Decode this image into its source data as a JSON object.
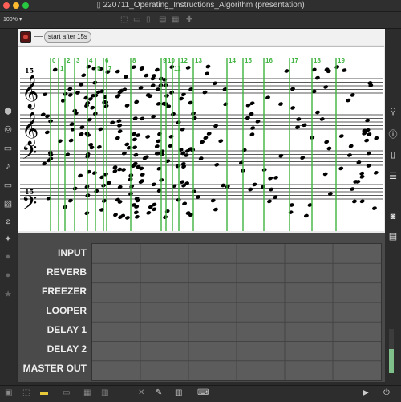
{
  "window": {
    "title": "220711_Operating_Instructions_Algorithm (presentation)"
  },
  "toolbar": {
    "zoom": "100%",
    "zoom_caret": "▾"
  },
  "patch": {
    "start_message": "start after 15s",
    "score": {
      "ottava_top": "15",
      "ottava_bottom": "15",
      "markers": [
        "0",
        "1",
        "2",
        "3",
        "4",
        "5",
        "6",
        "7",
        "8",
        "9",
        "10",
        "11",
        "12",
        "13",
        "14",
        "15",
        "16",
        "17",
        "18",
        "19"
      ]
    },
    "mixer_rows": [
      "INPUT",
      "REVERB",
      "FREEZER",
      "LOOPER",
      "DELAY 1",
      "DELAY 2",
      "MASTER OUT"
    ],
    "master_level": 0.55
  },
  "colors": {
    "marker_line": "#3fb33f",
    "record": "#d0413a",
    "traffic_red": "#ff5f57",
    "traffic_yellow": "#febc2e",
    "traffic_green": "#28c840"
  }
}
